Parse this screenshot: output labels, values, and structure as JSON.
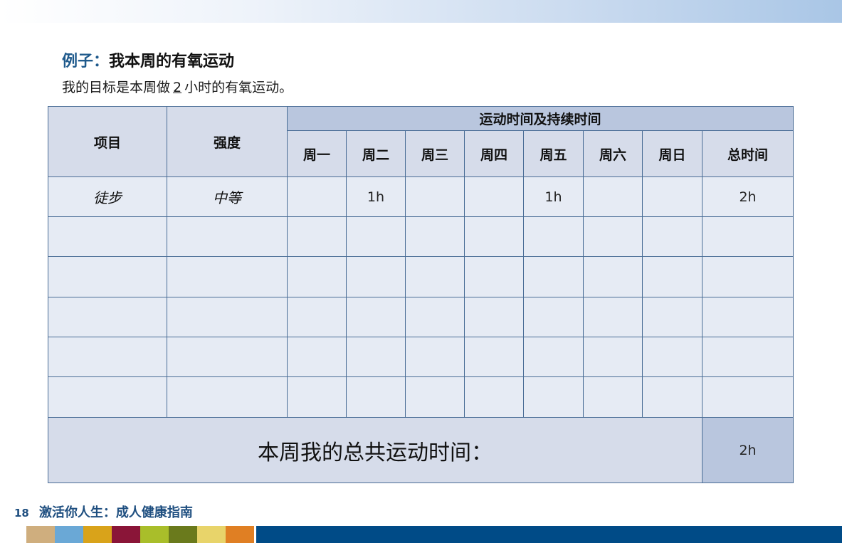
{
  "header": {
    "title_prefix": "例子：",
    "title_main": "我本周的有氧运动",
    "goal_before": "我的目标是本周做",
    "goal_value": "2",
    "goal_after": "小时的有氧运动。"
  },
  "table": {
    "col_item": "项目",
    "col_intensity": "强度",
    "group_header": "运动时间及持续时间",
    "days": [
      "周一",
      "周二",
      "周三",
      "周四",
      "周五",
      "周六",
      "周日"
    ],
    "col_total": "总时间",
    "rows": [
      {
        "item": "徒步",
        "intensity": "中等",
        "days": [
          "",
          "1h",
          "",
          "",
          "1h",
          "",
          ""
        ],
        "total": "2h"
      },
      {
        "item": "",
        "intensity": "",
        "days": [
          "",
          "",
          "",
          "",
          "",
          "",
          ""
        ],
        "total": ""
      },
      {
        "item": "",
        "intensity": "",
        "days": [
          "",
          "",
          "",
          "",
          "",
          "",
          ""
        ],
        "total": ""
      },
      {
        "item": "",
        "intensity": "",
        "days": [
          "",
          "",
          "",
          "",
          "",
          "",
          ""
        ],
        "total": ""
      },
      {
        "item": "",
        "intensity": "",
        "days": [
          "",
          "",
          "",
          "",
          "",
          "",
          ""
        ],
        "total": ""
      },
      {
        "item": "",
        "intensity": "",
        "days": [
          "",
          "",
          "",
          "",
          "",
          "",
          ""
        ],
        "total": ""
      }
    ],
    "weekly_total_label": "本周我的总共运动时间：",
    "weekly_total_value": "2h"
  },
  "footer": {
    "page_number": "18",
    "book_title": "激活你人生：成人健康指南"
  },
  "colors": {
    "accent_blue": "#1f4f80",
    "header_fill": "#d6dcea",
    "group_fill": "#b9c6de",
    "cell_fill": "#e6ebf4",
    "border": "#4a6d96",
    "stripes": [
      "#cfae7e",
      "#6aa8d6",
      "#d9a31a",
      "#8a1538",
      "#a9be2a",
      "#6a7a1c",
      "#e8d46a",
      "#e07f23"
    ],
    "bottom_bar": "#004b87"
  }
}
